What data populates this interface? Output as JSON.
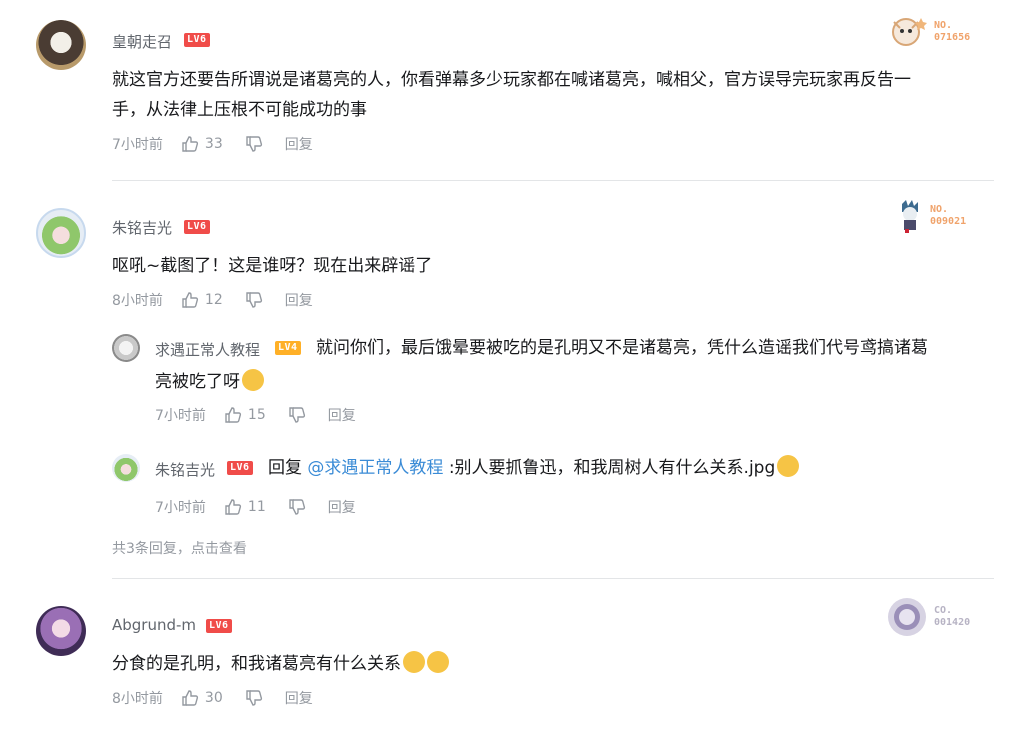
{
  "comments": [
    {
      "username": "皇朝走召",
      "level": "LV6",
      "badge_label": "NO.",
      "badge_number": "071656",
      "text_line1": "就这官方还要告所谓说是诸葛亮的人，你看弹幕多少玩家都在喊诸葛亮，喊相父，官方误导完玩家再反告一",
      "text_line2": "手，从法律上压根不可能成功的事",
      "time": "7小时前",
      "likes": "33",
      "reply_label": "回复"
    },
    {
      "username": "朱铭吉光",
      "level": "LV6",
      "badge_label": "NO.",
      "badge_number": "009021",
      "text": "呕吼~截图了！这是谁呀？现在出来辟谣了",
      "time": "8小时前",
      "likes": "12",
      "reply_label": "回复",
      "replies": [
        {
          "username": "求遇正常人教程",
          "level": "LV4",
          "text_line1": "就问你们，最后饿晕要被吃的是孔明又不是诸葛亮，凭什么造谣我们代号鸢搞诸葛",
          "text_line2": "亮被吃了呀",
          "time": "7小时前",
          "likes": "15",
          "reply_label": "回复"
        },
        {
          "username": "朱铭吉光",
          "level": "LV6",
          "reply_prefix": "回复",
          "mention": "@求遇正常人教程",
          "text": ":别人要抓鲁迅，和我周树人有什么关系.jpg",
          "time": "7小时前",
          "likes": "11",
          "reply_label": "回复"
        }
      ],
      "summary": "共3条回复，点击查看"
    },
    {
      "username": "Abgrund-m",
      "level": "LV6",
      "badge_label": "CO.",
      "badge_number": "001420",
      "text": "分食的是孔明，和我诸葛亮有什么关系",
      "time": "8小时前",
      "likes": "30",
      "reply_label": "回复"
    }
  ],
  "colors": {
    "level6": "#f04c49",
    "level4": "#ffb027",
    "mention": "#3a8bd6",
    "meta": "#9499a0"
  }
}
